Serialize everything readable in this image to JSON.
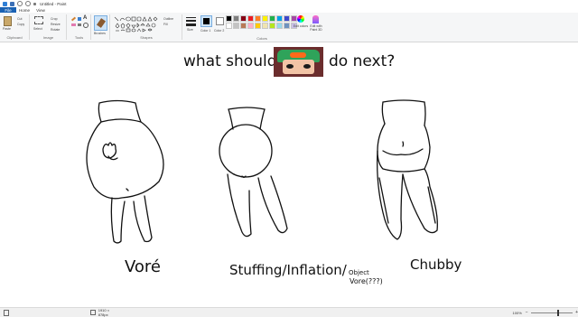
{
  "window": {
    "title": "Untitled - Paint"
  },
  "menu": {
    "file": "File",
    "home": "Home",
    "view": "View"
  },
  "ribbon": {
    "clipboard": {
      "paste": "Paste",
      "cut": "Cut",
      "copy": "Copy",
      "label": "Clipboard"
    },
    "image": {
      "select": "Select",
      "crop": "Crop",
      "resize": "Resize",
      "rotate": "Rotate",
      "label": "Image"
    },
    "tools": {
      "label": "Tools"
    },
    "brushes": {
      "label": "Brushes"
    },
    "shapes": {
      "outline": "Outline",
      "fill": "Fill",
      "label": "Shapes"
    },
    "size": {
      "label": "Size"
    },
    "color1": {
      "label": "Color 1"
    },
    "color2": {
      "label": "Color 2"
    },
    "colors": {
      "label": "Colors",
      "edit": "Edit colors",
      "paint3d": "Edit with Paint 3D",
      "swatches": [
        "#000000",
        "#7f7f7f",
        "#880015",
        "#ed1c24",
        "#ff7f27",
        "#fff200",
        "#22b14c",
        "#00a2e8",
        "#3f48cc",
        "#a349a4",
        "#ffffff",
        "#c3c3c3",
        "#b97a57",
        "#ffaec9",
        "#ffc90e",
        "#efe4b0",
        "#b5e61d",
        "#99d9ea",
        "#7092be",
        "#c8bfe7"
      ]
    }
  },
  "drawing": {
    "question_left": "what should",
    "question_right": "do next?",
    "label_vore": "Voré",
    "label_stuffing": "Stuffing/Inflation/",
    "label_object": "Object",
    "label_vore2": "Vore(???)",
    "label_chubby": "Chubby"
  },
  "status": {
    "dimensions": "1910 × 878px",
    "zoom": "100%"
  }
}
